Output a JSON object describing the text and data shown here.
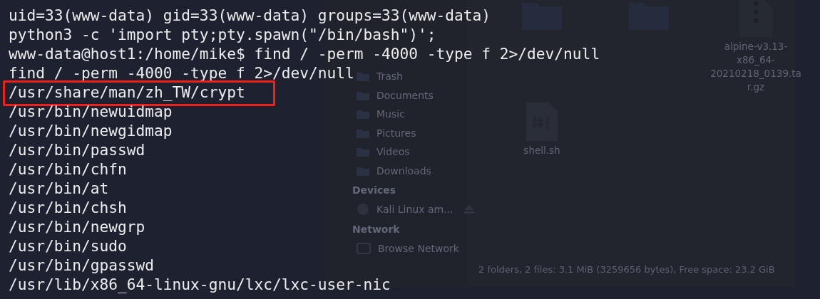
{
  "terminal": {
    "lines": [
      {
        "text": "uid=33(www-data) gid=33(www-data) groups=33(www-data)",
        "highlighted": false
      },
      {
        "text": "python3 -c 'import pty;pty.spawn(\"/bin/bash\")';",
        "highlighted": false
      },
      {
        "text": "www-data@host1:/home/mike$ find / -perm -4000 -type f 2>/dev/null",
        "highlighted": false
      },
      {
        "text": "find / -perm -4000 -type f 2>/dev/null",
        "highlighted": false
      },
      {
        "text": "/usr/share/man/zh_TW/crypt",
        "highlighted": true
      },
      {
        "text": "/usr/bin/newuidmap",
        "highlighted": false
      },
      {
        "text": "/usr/bin/newgidmap",
        "highlighted": false
      },
      {
        "text": "/usr/bin/passwd",
        "highlighted": false
      },
      {
        "text": "/usr/bin/chfn",
        "highlighted": false
      },
      {
        "text": "/usr/bin/at",
        "highlighted": false
      },
      {
        "text": "/usr/bin/chsh",
        "highlighted": false
      },
      {
        "text": "/usr/bin/newgrp",
        "highlighted": false
      },
      {
        "text": "/usr/bin/sudo",
        "highlighted": false
      },
      {
        "text": "/usr/bin/gpasswd",
        "highlighted": false
      },
      {
        "text": "/usr/lib/x86_64-linux-gnu/lxc/lxc-user-nic",
        "highlighted": false
      }
    ]
  },
  "file_manager": {
    "sidebar": {
      "items": [
        {
          "kind": "place",
          "label": "Trash"
        },
        {
          "kind": "place",
          "label": "Documents"
        },
        {
          "kind": "place",
          "label": "Music"
        },
        {
          "kind": "place",
          "label": "Pictures"
        },
        {
          "kind": "place",
          "label": "Videos"
        },
        {
          "kind": "place",
          "label": "Downloads"
        },
        {
          "kind": "heading",
          "label": "Devices"
        },
        {
          "kind": "drive",
          "label": "Kali Linux am..."
        },
        {
          "kind": "heading",
          "label": "Network"
        },
        {
          "kind": "network",
          "label": "Browse Network"
        }
      ]
    },
    "files": [
      {
        "kind": "folder"
      },
      {
        "kind": "folder"
      },
      {
        "kind": "archive",
        "name": "alpine-v3.13-x86_64-20210218_0139.tar.gz"
      },
      {
        "kind": "script",
        "name": "shell.sh"
      }
    ],
    "status_bar": "2 folders, 2 files: 3.1 MiB (3259656 bytes), Free space: 23.2 GiB"
  }
}
